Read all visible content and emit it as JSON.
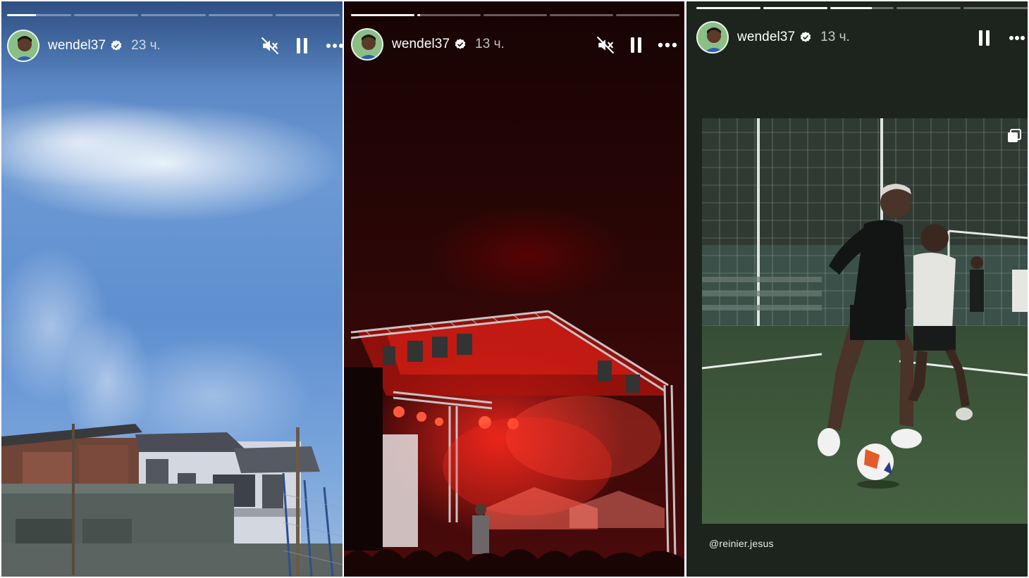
{
  "stories": [
    {
      "username": "wendel37",
      "age": "23 ч.",
      "segments": 5,
      "active_segment": 0,
      "active_progress": 0.45,
      "muted": true,
      "background": "sky-buildings"
    },
    {
      "username": "wendel37",
      "age": "13 ч.",
      "segments": 5,
      "active_segment": 1,
      "active_progress": 0.04,
      "muted": true,
      "background": "concert-stage"
    },
    {
      "username": "wendel37",
      "age": "13 ч.",
      "segments": 5,
      "active_segment": 2,
      "active_progress": 0.65,
      "muted": false,
      "background": "football-pitch",
      "caption": "@reinier.jesus"
    }
  ],
  "icons": {
    "mute": "speaker-muted-icon",
    "pause": "pause-icon",
    "more": "more-options-icon",
    "verified": "verified-badge-icon",
    "multi": "multi-image-icon"
  },
  "colors": {
    "verified": "#ffffff",
    "panel3_bg": "#1d241d",
    "stage_red": "#ff2a1e"
  }
}
